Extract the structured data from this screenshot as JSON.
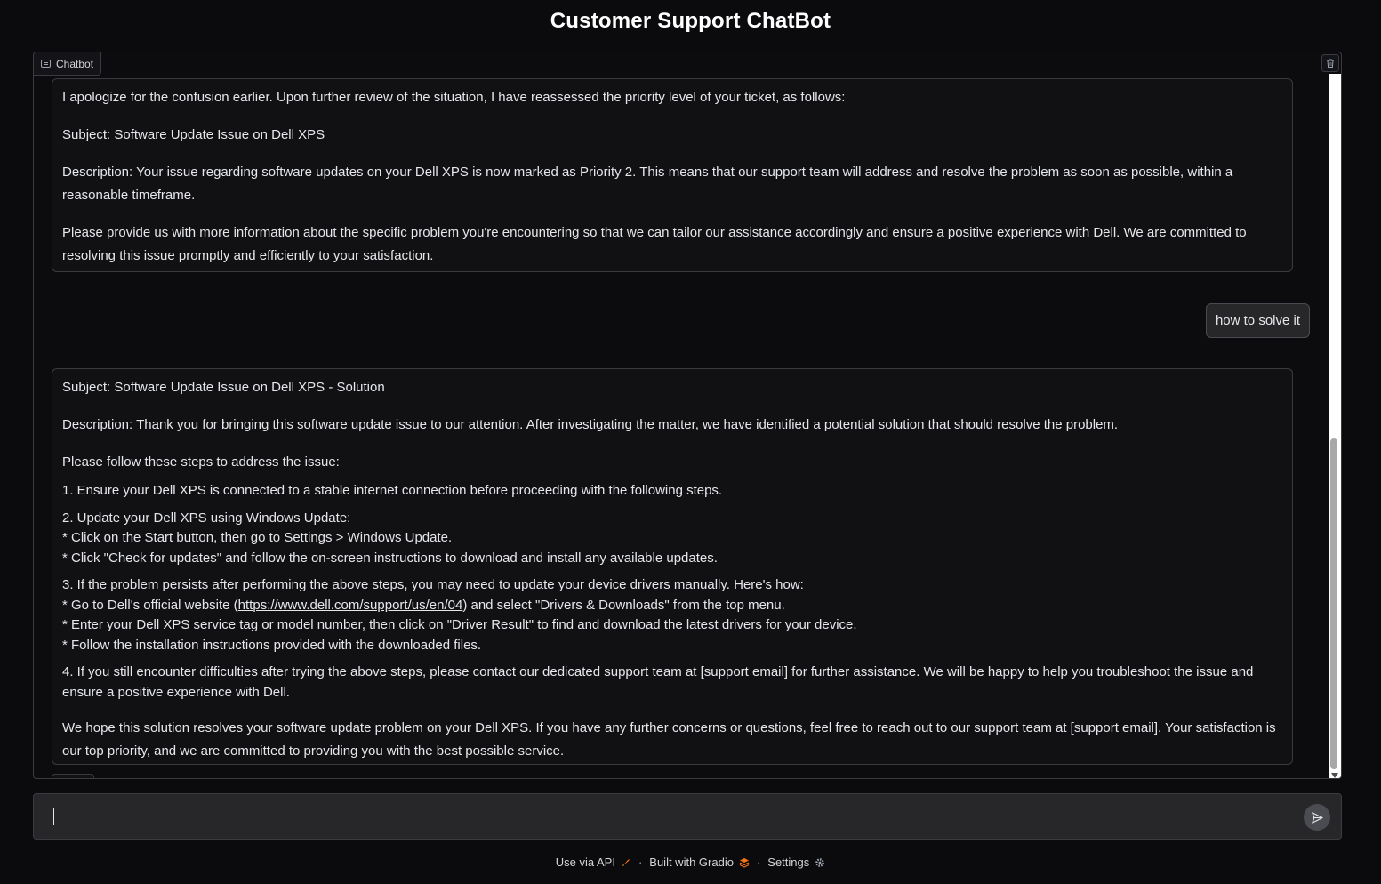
{
  "app": {
    "title": "Customer Support ChatBot"
  },
  "chatbot": {
    "label": "Chatbot",
    "messages": [
      {
        "role": "bot",
        "paragraphs": [
          "I apologize for the confusion earlier. Upon further review of the situation, I have reassessed the priority level of your ticket, as follows:",
          "Subject: Software Update Issue on Dell XPS",
          "Description: Your issue regarding software updates on your Dell XPS is now marked as Priority 2. This means that our support team will address and resolve the problem as soon as possible, within a reasonable timeframe.",
          "Please provide us with more information about the specific problem you're encountering so that we can tailor our assistance accordingly and ensure a positive experience with Dell. We are committed to resolving this issue promptly and efficiently to your satisfaction."
        ]
      },
      {
        "role": "user",
        "text": "how to solve it"
      },
      {
        "role": "bot",
        "subject": "Subject: Software Update Issue on Dell XPS - Solution",
        "description": "Description: Thank you for bringing this software update issue to our attention. After investigating the matter, we have identified a potential solution that should resolve the problem.",
        "intro": "Please follow these steps to address the issue:",
        "step1": "1. Ensure your Dell XPS is connected to a stable internet connection before proceeding with the following steps.",
        "step2_title": "2. Update your Dell XPS using Windows Update:",
        "step2_a": "* Click on the Start button, then go to Settings > Windows Update.",
        "step2_b": "* Click \"Check for updates\" and follow the on-screen instructions to download and install any available updates.",
        "step3_title": "3. If the problem persists after performing the above steps, you may need to update your device drivers manually. Here's how:",
        "step3_a_pre": "* Go to Dell's official website (",
        "step3_a_link": "https://www.dell.com/support/us/en/04",
        "step3_a_post": ") and select \"Drivers & Downloads\" from the top menu.",
        "step3_b": "* Enter your Dell XPS service tag or model number, then click on \"Driver Result\" to find and download the latest drivers for your device.",
        "step3_c": "* Follow the installation instructions provided with the downloaded files.",
        "step4": "4. If you still encounter difficulties after trying the above steps, please contact our dedicated support team at [support email] for further assistance. We will be happy to help you troubleshoot the issue and ensure a positive experience with Dell.",
        "closing": "We hope this solution resolves your software update problem on your Dell XPS. If you have any further concerns or questions, feel free to reach out to our support team at [support email]. Your satisfaction is our top priority, and we are committed to providing you with the best possible service."
      }
    ]
  },
  "input": {
    "value": ""
  },
  "footer": {
    "api": "Use via API",
    "built": "Built with Gradio",
    "settings": "Settings",
    "separator": "·"
  }
}
